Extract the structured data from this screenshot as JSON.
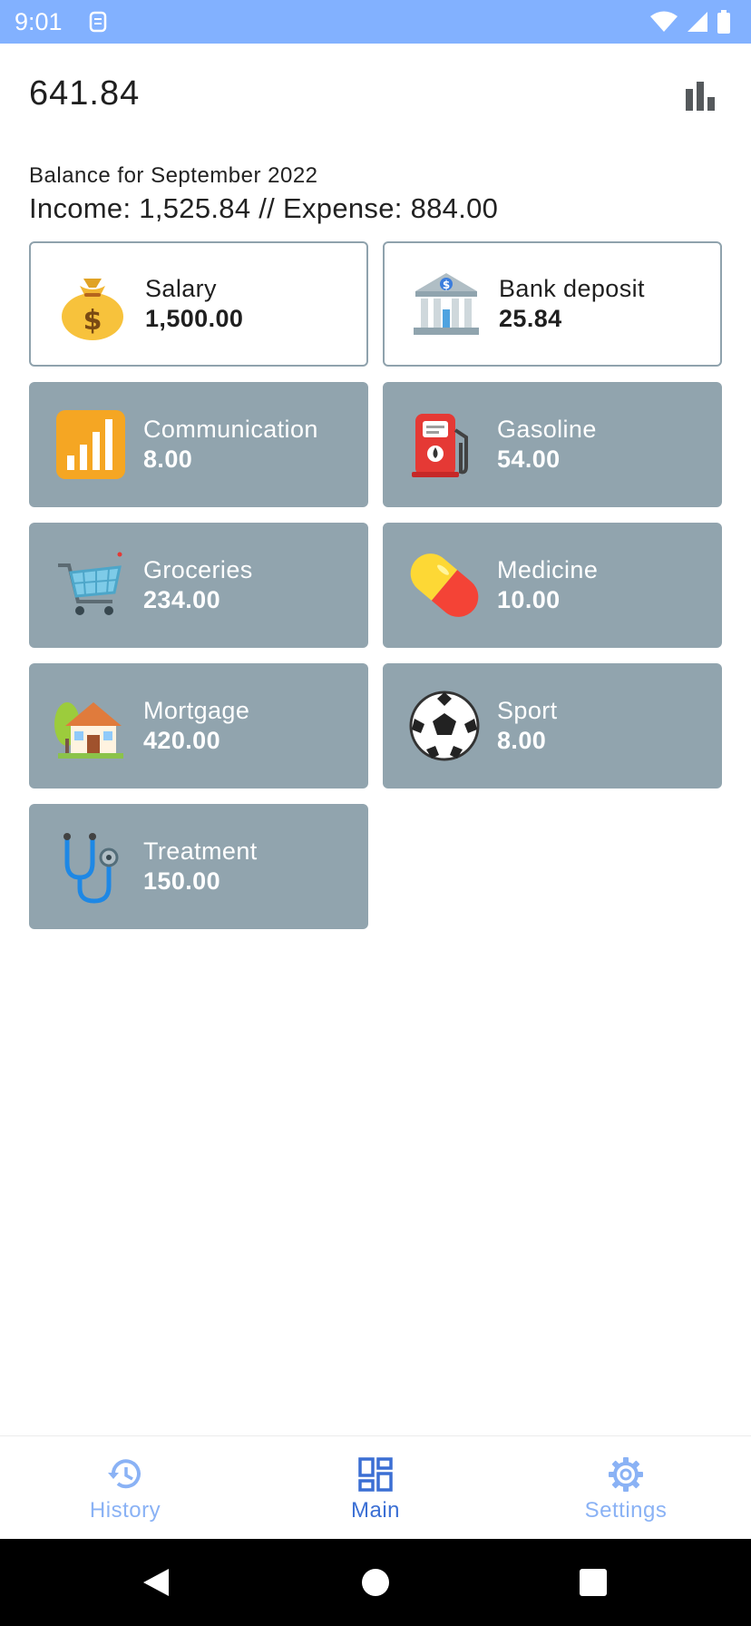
{
  "status_bar": {
    "time": "9:01"
  },
  "header": {
    "total": "641.84"
  },
  "summary": {
    "balance_label": "Balance for September 2022",
    "totals": "Income: 1,525.84 // Expense: 884.00"
  },
  "income_tiles": [
    {
      "name": "Salary",
      "amount": "1,500.00",
      "icon": "money-bag-icon"
    },
    {
      "name": "Bank deposit",
      "amount": "25.84",
      "icon": "bank-icon"
    }
  ],
  "expense_tiles": [
    {
      "name": "Communication",
      "amount": "8.00",
      "icon": "signal-bars-icon"
    },
    {
      "name": "Gasoline",
      "amount": "54.00",
      "icon": "fuel-pump-icon"
    },
    {
      "name": "Groceries",
      "amount": "234.00",
      "icon": "shopping-cart-icon"
    },
    {
      "name": "Medicine",
      "amount": "10.00",
      "icon": "pill-icon"
    },
    {
      "name": "Mortgage",
      "amount": "420.00",
      "icon": "house-icon"
    },
    {
      "name": "Sport",
      "amount": "8.00",
      "icon": "soccer-ball-icon"
    },
    {
      "name": "Treatment",
      "amount": "150.00",
      "icon": "stethoscope-icon"
    }
  ],
  "bottom_nav": {
    "items": [
      {
        "label": "History",
        "icon": "history-icon",
        "active": false
      },
      {
        "label": "Main",
        "icon": "dashboard-icon",
        "active": true
      },
      {
        "label": "Settings",
        "icon": "gear-icon",
        "active": false
      }
    ]
  },
  "colors": {
    "status_bar": "#82b1ff",
    "expense_tile": "#91a4ae",
    "income_tile_border": "#8fa2ad",
    "nav_active": "#3b6fd4",
    "nav_inactive": "#8ab2f5"
  }
}
